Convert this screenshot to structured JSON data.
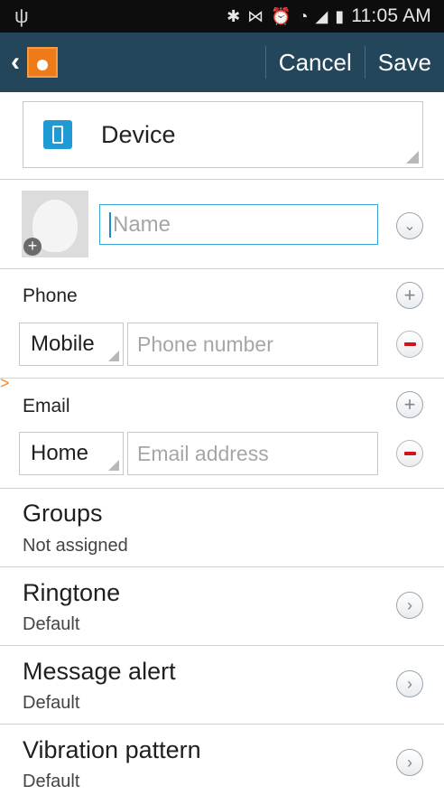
{
  "status_bar": {
    "time": "11:05 AM",
    "usb_icon": "usb-icon",
    "icons": [
      "bluetooth-icon",
      "nfc-icon",
      "alarm-icon",
      "wifi-icon",
      "signal-icon",
      "battery-icon"
    ]
  },
  "action_bar": {
    "cancel_label": "Cancel",
    "save_label": "Save",
    "background": "#23465b"
  },
  "storage": {
    "label": "Device"
  },
  "name": {
    "placeholder": "Name"
  },
  "phone": {
    "section_label": "Phone",
    "type": "Mobile",
    "placeholder": "Phone number"
  },
  "email": {
    "section_label": "Email",
    "type": "Home",
    "placeholder": "Email address"
  },
  "settings": [
    {
      "title": "Groups",
      "value": "Not assigned"
    },
    {
      "title": "Ringtone",
      "value": "Default"
    },
    {
      "title": "Message alert",
      "value": "Default"
    },
    {
      "title": "Vibration pattern",
      "value": "Default"
    }
  ]
}
